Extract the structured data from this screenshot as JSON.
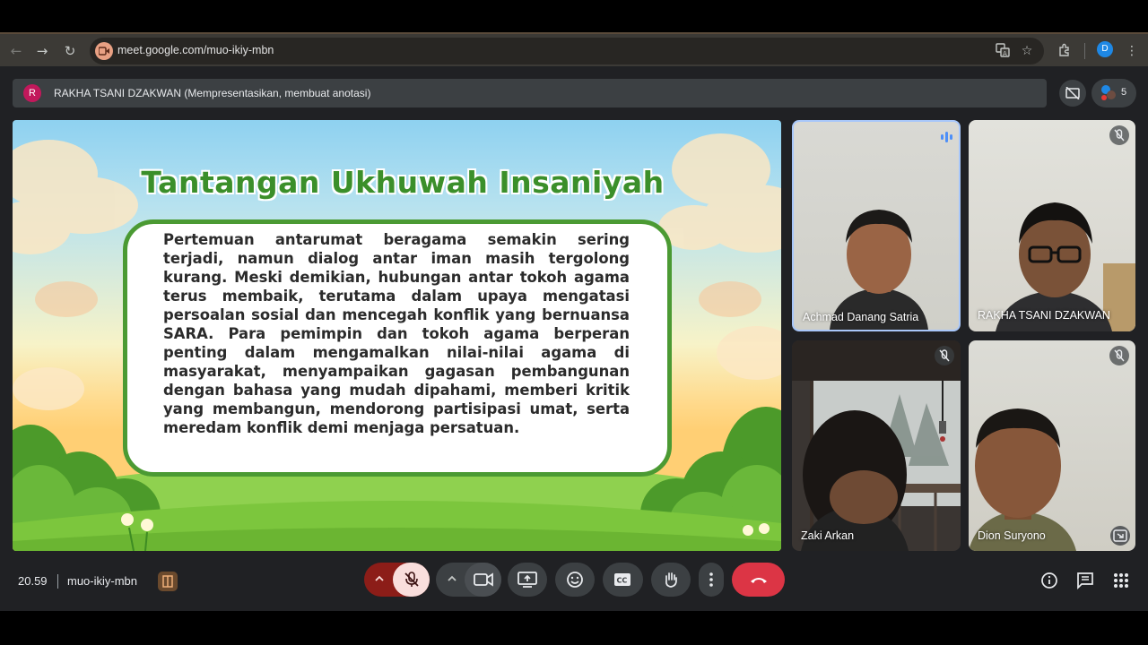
{
  "browser": {
    "url": "meet.google.com/muo-ikiy-mbn",
    "profile_initial": "D"
  },
  "presenter_bar": {
    "avatar_initial": "R",
    "text": "RAKHA TSANI DZAKWAN (Mempresentasikan, membuat anotasi)",
    "participant_count": "5"
  },
  "slide": {
    "title": "Tantangan Ukhuwah Insaniyah",
    "body": "Pertemuan antarumat beragama semakin sering terjadi, namun dialog antar iman masih tergolong kurang. Meski demikian, hubungan antar tokoh agama terus membaik, terutama dalam upaya mengatasi persoalan sosial dan mencegah konflik yang bernuansa SARA. Para pemimpin dan tokoh agama berperan penting dalam mengamalkan nilai-nilai agama di masyarakat, menyampaikan gagasan pembangunan dengan bahasa yang mudah dipahami, memberi kritik yang membangun, mendorong partisipasi umat, serta meredam konflik demi menjaga persatuan."
  },
  "participants": [
    {
      "name": "Achmad Danang Satria",
      "state": "speaking"
    },
    {
      "name": "RAKHA TSANI DZAKWAN",
      "state": "muted"
    },
    {
      "name": "Zaki Arkan",
      "state": "muted"
    },
    {
      "name": "Dion Suryono",
      "state": "muted"
    }
  ],
  "bottom_bar": {
    "time": "20.59",
    "meeting_code": "muo-ikiy-mbn"
  },
  "colors": {
    "end_call": "#dc3545",
    "mic_off": "#f9dedc",
    "mic_caret": "#8c1d18",
    "speaking_border": "#a8c7fa",
    "title_green": "#3b8f2a"
  }
}
